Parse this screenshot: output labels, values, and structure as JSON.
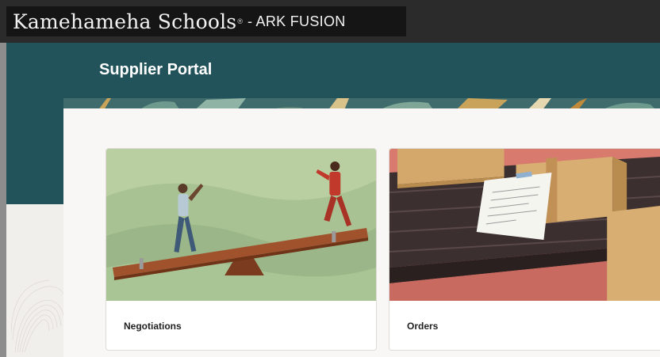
{
  "header": {
    "brand_name": "Kamehameha Schools",
    "brand_reg": "®",
    "brand_suffix": "- ARK FUSION"
  },
  "page": {
    "title": "Supplier Portal"
  },
  "cards": [
    {
      "label": "Negotiations",
      "image": "seesaw-illustration"
    },
    {
      "label": "Orders",
      "image": "conveyor-boxes-illustration"
    }
  ],
  "colors": {
    "topbar": "#2b2b2b",
    "brand_block": "#151515",
    "hero_teal": "#22535a",
    "panel": "#f8f7f5",
    "background": "#f1efec"
  }
}
